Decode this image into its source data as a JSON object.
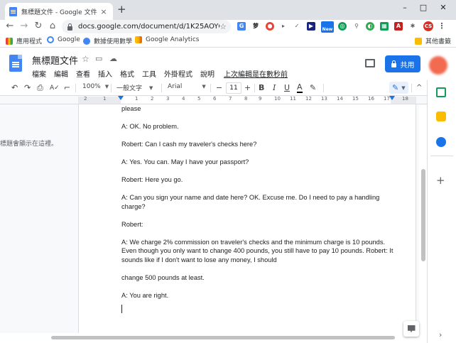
{
  "browser": {
    "tab_title": "無標題文件 - Google 文件",
    "tab_close": "×",
    "new_tab": "+",
    "window_min": "–",
    "window_max": "□",
    "window_close": "✕",
    "back": "←",
    "forward": "→",
    "reload": "↻",
    "home": "⌂",
    "url": "docs.google.com/document/d/1K25AOYQ...",
    "star": "☆",
    "menu": "⋮",
    "avatar_initials": "CS",
    "new_badge": "New"
  },
  "bookmarks": {
    "items": [
      {
        "label": "應用程式",
        "color": "#ea4335"
      },
      {
        "label": "Google",
        "color": "#4285f4"
      },
      {
        "label": "數據使用數學",
        "color": "#4285f4"
      },
      {
        "label": "Google Analytics",
        "color": "#f9ab00"
      }
    ],
    "other": "其他書籤"
  },
  "docs": {
    "title": "無標題文件",
    "menus": [
      "檔案",
      "編輯",
      "查看",
      "插入",
      "格式",
      "工具",
      "外掛程式",
      "說明"
    ],
    "last_edit": "上次編輯是在數秒前",
    "share_label": "共用"
  },
  "toolbar": {
    "undo": "↶",
    "redo": "↷",
    "print": "⎙",
    "spell": "A✓",
    "paint": "⌐",
    "zoom": "100%",
    "style": "一般文字",
    "font": "Arial",
    "minus": "−",
    "font_size": "11",
    "plus": "+",
    "bold": "B",
    "italic": "I",
    "underline": "U",
    "text_color": "A",
    "highlight": "✎",
    "editing": "✎",
    "collapse": "^"
  },
  "ruler": {
    "numbers": [
      "2",
      "1",
      "1",
      "2",
      "3",
      "4",
      "5",
      "6",
      "7",
      "8",
      "9",
      "10",
      "11",
      "12",
      "13",
      "14",
      "15",
      "16",
      "17",
      "18"
    ]
  },
  "outline_note": "標題會顯示在這裡。",
  "document": {
    "paragraphs": [
      "please",
      "A: OK. No problem.",
      "Robert: Can I cash my traveler's checks here?",
      "A: Yes. You can. May I have your passport?",
      "Robert: Here you go.",
      "A: Can you sign your name and date here? OK. Excuse me. Do I need to pay a handling charge?",
      "Robert:",
      "A: We charge 2% commission on traveler's checks and the minimum charge is 10 pounds. Even though you only want to change 400 pounds, you still have to pay 10 pounds. Robert: It sounds like if I don't want to lose any money, I should",
      "change 500 pounds at least.",
      "A: You are right."
    ]
  },
  "sidepanel": {
    "add": "+",
    "icons": [
      {
        "name": "sheets-icon",
        "color": "#0f9d58"
      },
      {
        "name": "keep-icon",
        "color": "#fbbc04"
      },
      {
        "name": "tasks-icon",
        "color": "#1a73e8"
      }
    ],
    "expand": "›"
  },
  "colors": {
    "accent": "#1a73e8",
    "docs_blue": "#4285f4"
  }
}
